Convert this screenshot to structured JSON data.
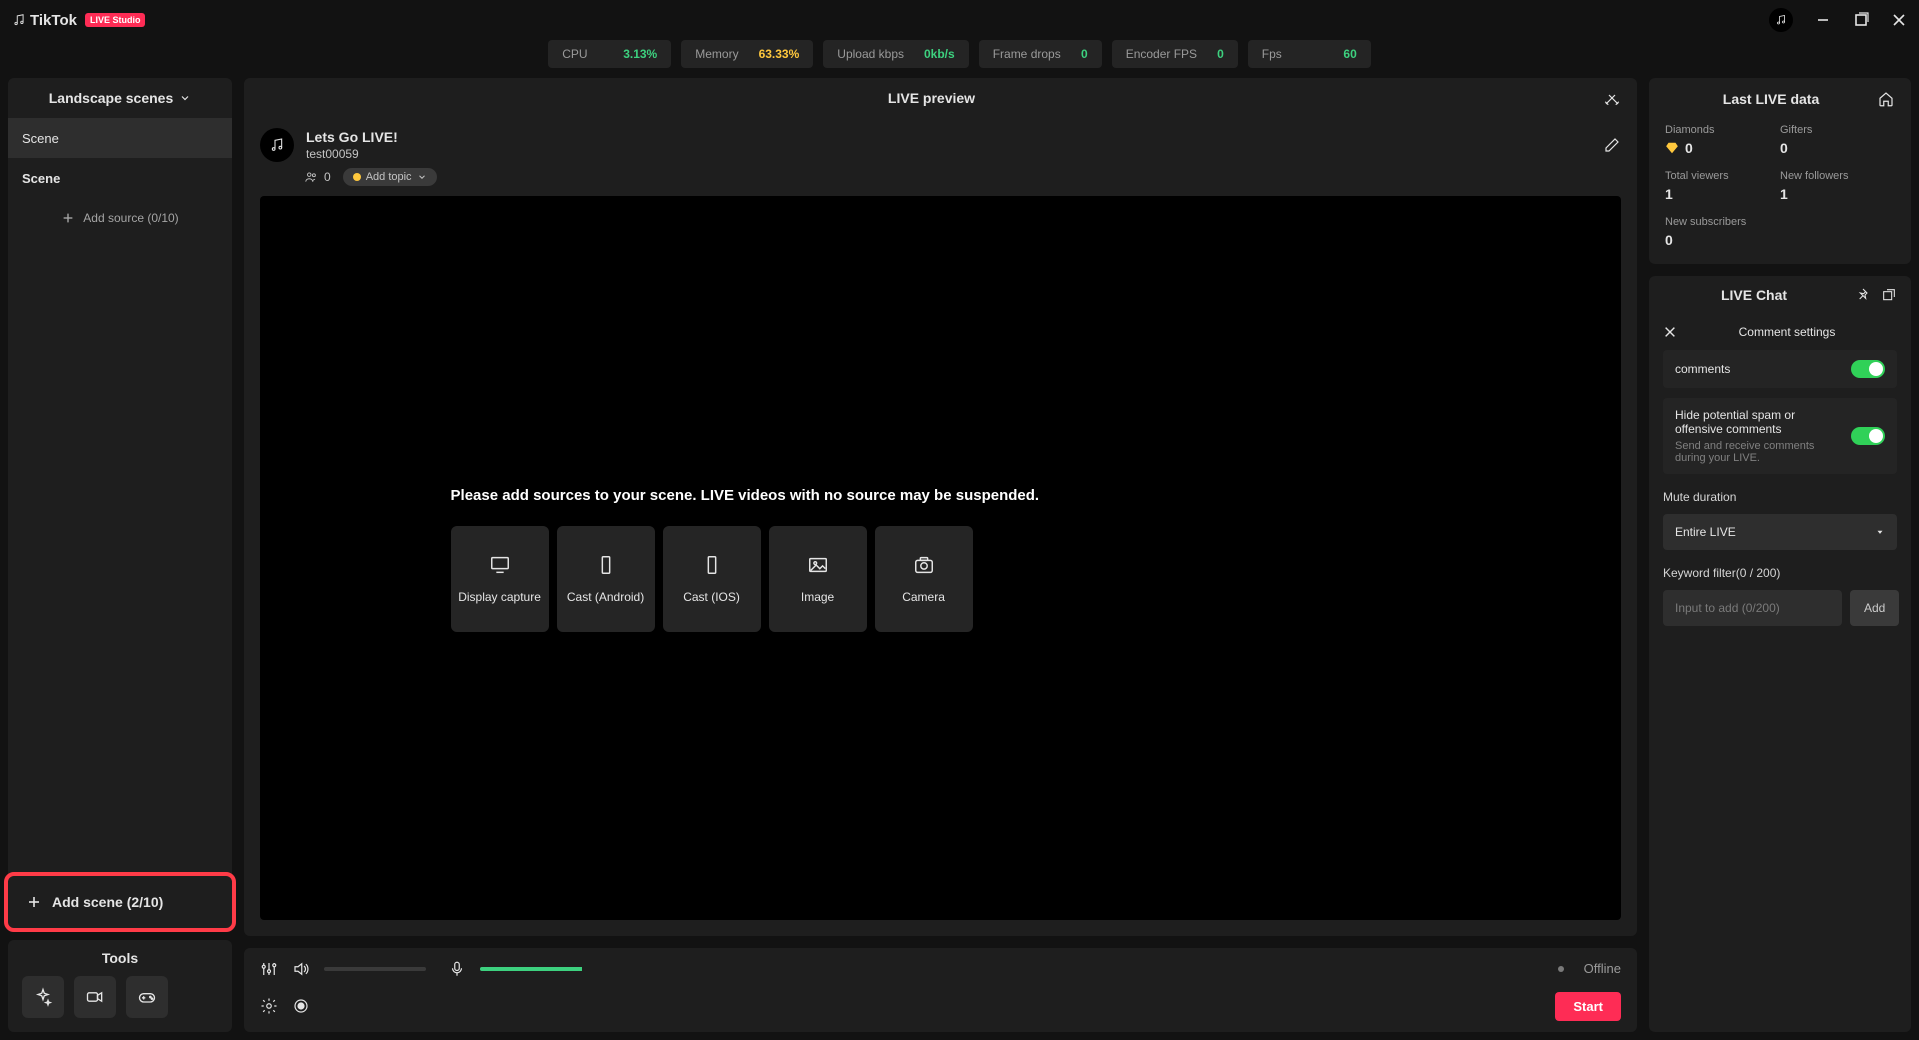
{
  "titlebar": {
    "app_name": "TikTok",
    "badge": "LIVE Studio"
  },
  "stats": {
    "cpu_label": "CPU",
    "cpu_value": "3.13%",
    "mem_label": "Memory",
    "mem_value": "63.33%",
    "upload_label": "Upload kbps",
    "upload_value": "0kb/s",
    "frames_label": "Frame drops",
    "frames_value": "0",
    "enc_label": "Encoder FPS",
    "enc_value": "0",
    "fps_label": "Fps",
    "fps_value": "60"
  },
  "sidebar": {
    "header": "Landscape scenes",
    "scenes": [
      {
        "label": "Scene"
      },
      {
        "label": "Scene"
      }
    ],
    "add_source": "Add source (0/10)",
    "add_scene": "Add scene (2/10)"
  },
  "tools": {
    "header": "Tools"
  },
  "preview": {
    "header": "LIVE preview",
    "stream_title": "Lets Go LIVE!",
    "username": "test00059",
    "viewers": "0",
    "add_topic": "Add topic",
    "message": "Please add sources to your scene. LIVE videos with no source may be suspended.",
    "sources": [
      {
        "label": "Display capture"
      },
      {
        "label": "Cast (Android)"
      },
      {
        "label": "Cast (IOS)"
      },
      {
        "label": "Image"
      },
      {
        "label": "Camera"
      }
    ]
  },
  "footer": {
    "status": "Offline",
    "start": "Start"
  },
  "last": {
    "header": "Last LIVE data",
    "diamonds_label": "Diamonds",
    "diamonds_value": "0",
    "gifters_label": "Gifters",
    "gifters_value": "0",
    "viewers_label": "Total viewers",
    "viewers_value": "1",
    "followers_label": "New followers",
    "followers_value": "1",
    "subs_label": "New subscribers",
    "subs_value": "0"
  },
  "chat": {
    "header": "LIVE Chat",
    "sub": "Comment settings",
    "comments_label": "comments",
    "spam_label": "Hide potential spam or offensive comments",
    "spam_hint": "Send and receive comments during your LIVE.",
    "mute_label": "Mute duration",
    "mute_value": "Entire LIVE",
    "kw_label": "Keyword filter(0 / 200)",
    "kw_placeholder": "Input to add (0/200)",
    "kw_add": "Add"
  }
}
